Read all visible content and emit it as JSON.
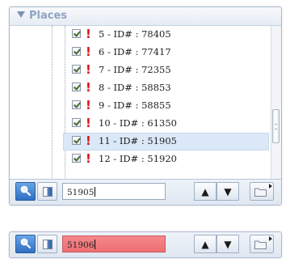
{
  "panel": {
    "title": "Places",
    "rows": [
      {
        "label": "5 - ID# : 78405",
        "checked": true,
        "selected": false
      },
      {
        "label": "6 - ID# : 77417",
        "checked": true,
        "selected": false
      },
      {
        "label": "7 - ID# : 72355",
        "checked": true,
        "selected": false
      },
      {
        "label": "8 - ID# : 58853",
        "checked": true,
        "selected": false
      },
      {
        "label": "9 - ID# : 58855",
        "checked": true,
        "selected": false
      },
      {
        "label": "10 - ID# : 61350",
        "checked": true,
        "selected": false
      },
      {
        "label": "11 - ID# : 51905",
        "checked": true,
        "selected": true
      },
      {
        "label": "12 - ID# : 51920",
        "checked": true,
        "selected": false
      }
    ]
  },
  "search_top": {
    "value": "51905",
    "state": "normal"
  },
  "search_bottom": {
    "value": "51906",
    "state": "error"
  },
  "icons": {
    "search": "magnifier-icon",
    "panel_toggle": "panel-toggle-icon",
    "prev": "up-arrow-icon",
    "next": "down-arrow-icon",
    "folder": "folder-icon",
    "warning": "exclamation-icon"
  },
  "colors": {
    "header_text": "#8fa3c2",
    "warning": "#e0141b",
    "selected_row": "#dbe8f8",
    "active_button": "#2f6fc2",
    "error_field": "#ee6e71"
  },
  "symbols": {
    "up": "▲",
    "down": "▼",
    "warning": "!"
  }
}
